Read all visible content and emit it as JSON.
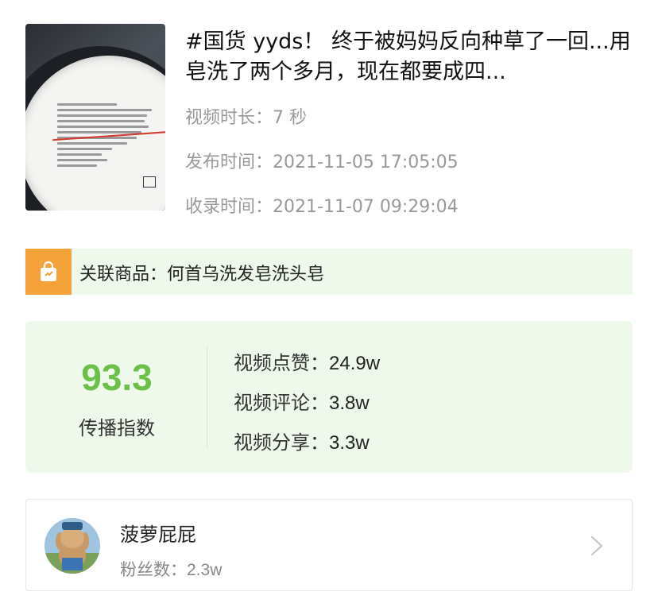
{
  "video": {
    "title": "#国货 yyds！ 终于被妈妈反向种草了一回...用皂洗了两个多月，现在都要成四...",
    "duration_label": "视频时长：",
    "duration_value": "7 秒",
    "publish_label": "发布时间：",
    "publish_value": "2021-11-05 17:05:05",
    "collect_label": "收录时间：",
    "collect_value": "2021-11-07 09:29:04",
    "thumbnail_icon": "video-thumbnail"
  },
  "product": {
    "icon": "shopping-bag-icon",
    "text": "关联商品：何首乌洗发皂洗头皂"
  },
  "index": {
    "score": "93.3",
    "score_label": "传播指数",
    "likes_label": "视频点赞：",
    "likes_value": "24.9w",
    "comments_label": "视频评论：",
    "comments_value": "3.8w",
    "shares_label": "视频分享：",
    "shares_value": "3.3w"
  },
  "author": {
    "name": "菠萝屁屁",
    "fans_label": "粉丝数：",
    "fans_value": "2.3w",
    "chevron": "chevron-right-icon"
  },
  "colors": {
    "accent_green": "#6cc04a",
    "panel_bg": "#eef9ec",
    "bag_orange": "#f3a33a"
  }
}
